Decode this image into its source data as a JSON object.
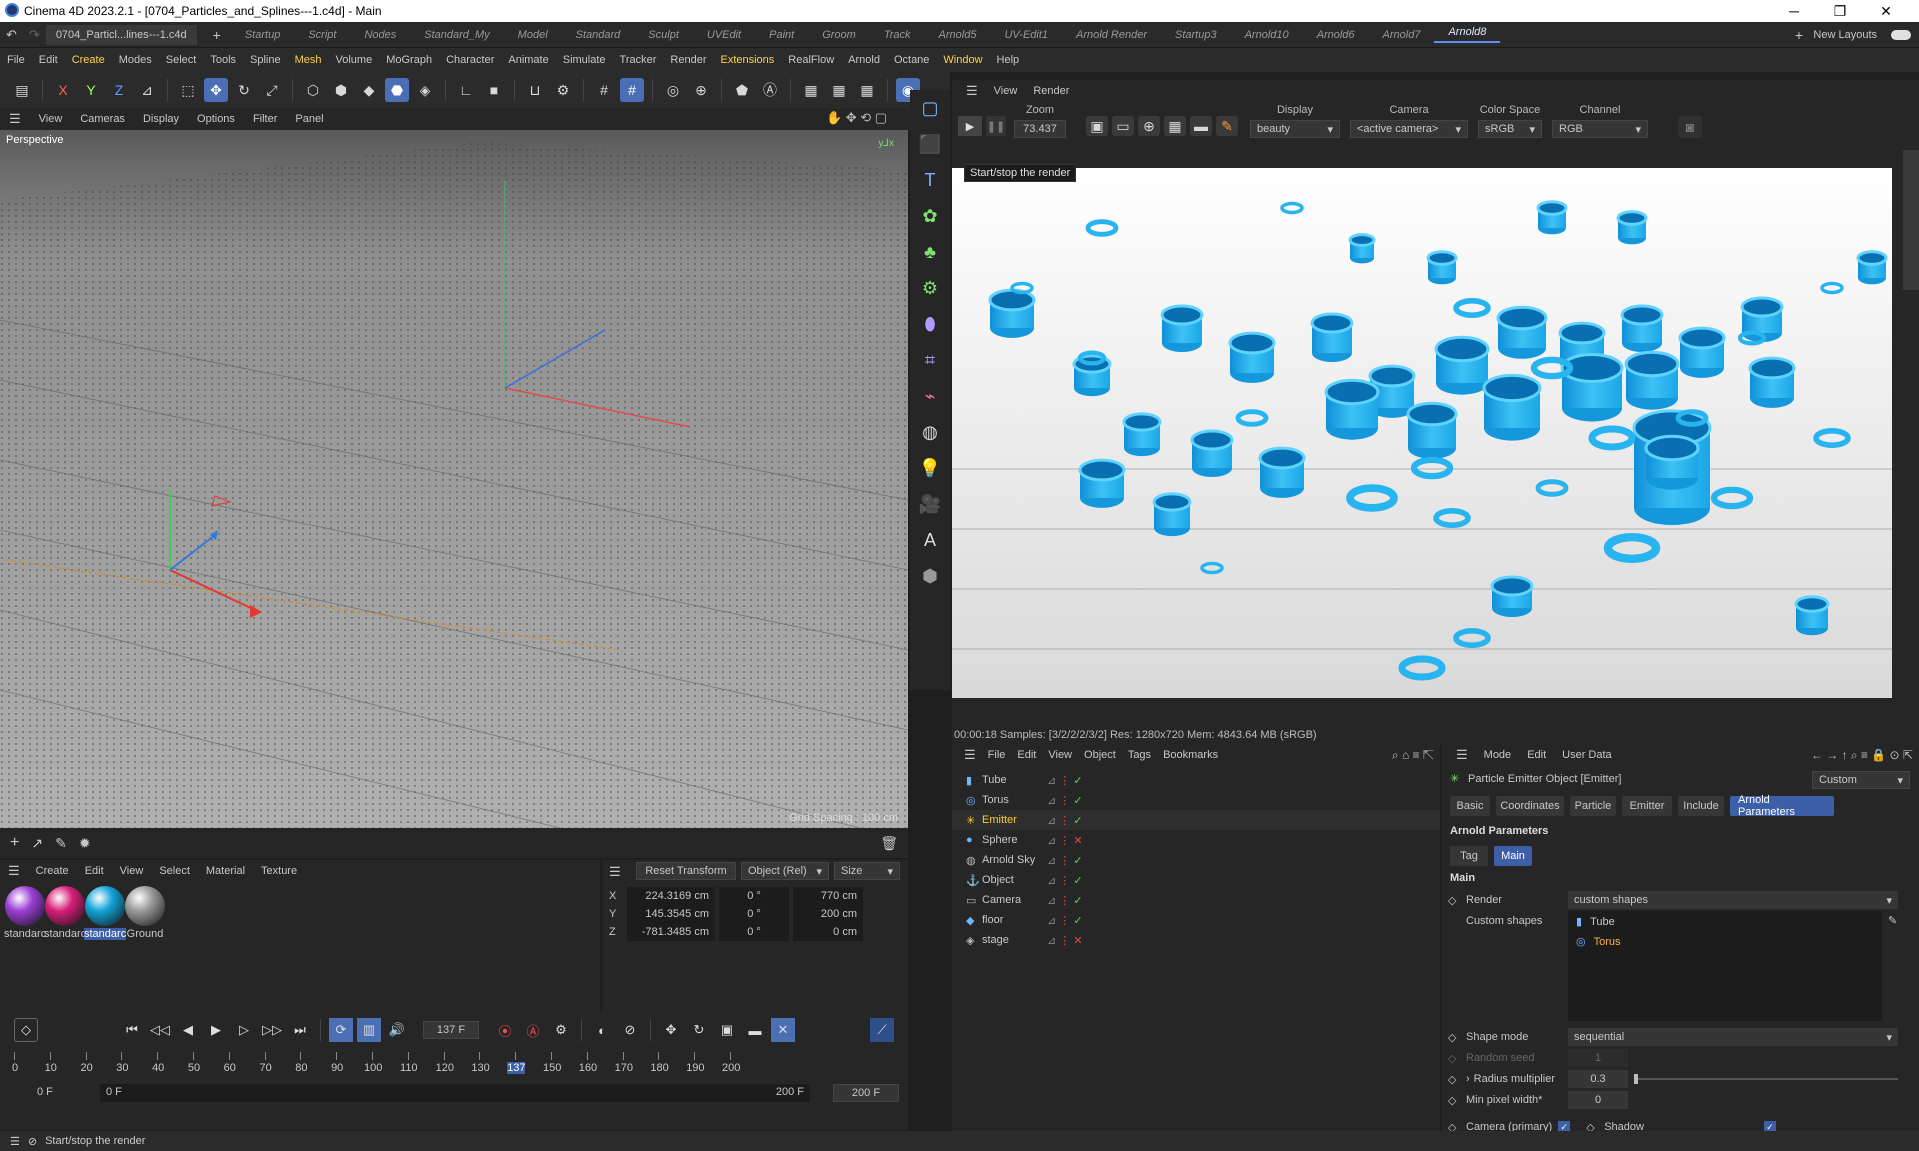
{
  "window": {
    "title": "Cinema 4D 2023.2.1 - [0704_Particles_and_Splines---1.c4d] - Main",
    "minimize": "─",
    "maximize": "❐",
    "close": "✕"
  },
  "file_tab": {
    "label": "0704_Particl...lines---1.c4d",
    "add": "+"
  },
  "layout_tabs": [
    "Startup",
    "Script",
    "Nodes",
    "Standard_My",
    "Model",
    "Standard",
    "Sculpt",
    "UVEdit",
    "Paint",
    "Groom",
    "Track",
    "Arnold5",
    "UV-Edit1",
    "Arnold Render",
    "Startup3",
    "Arnold10",
    "Arnold6",
    "Arnold7",
    "Arnold8"
  ],
  "active_layout": "Arnold8",
  "new_layouts": "New Layouts",
  "menu": [
    "File",
    "Edit",
    "Create",
    "Modes",
    "Select",
    "Tools",
    "Spline",
    "Mesh",
    "Volume",
    "MoGraph",
    "Character",
    "Animate",
    "Simulate",
    "Tracker",
    "Render",
    "Extensions",
    "RealFlow",
    "Arnold",
    "Octane",
    "Window",
    "Help"
  ],
  "menu_highlight": [
    "Create",
    "Mesh",
    "Extensions",
    "Window"
  ],
  "viewport_menu": [
    "View",
    "Cameras",
    "Display",
    "Options",
    "Filter",
    "Panel"
  ],
  "viewport": {
    "label": "Perspective",
    "grid_info": "Grid Spacing : 100 cm"
  },
  "render_view": {
    "menu": [
      "View",
      "Render"
    ],
    "zoom_label": "Zoom",
    "zoom_value": "73.437",
    "display_label": "Display",
    "display_value": "beauty",
    "camera_label": "Camera",
    "camera_value": "<active camera>",
    "colorspace_label": "Color Space",
    "colorspace_value": "sRGB",
    "channel_label": "Channel",
    "channel_value": "RGB",
    "tooltip": "Start/stop the render",
    "status": "00:00:18  Samples: [3/2/2/2/3/2]  Res: 1280x720  Mem: 4843.64 MB  (sRGB)"
  },
  "material_menu": [
    "Create",
    "Edit",
    "View",
    "Select",
    "Material",
    "Texture"
  ],
  "materials": [
    {
      "label": "standarc",
      "color": "#9b3fd6"
    },
    {
      "label": "standarc",
      "color": "#d81f79"
    },
    {
      "label": "standarc",
      "color": "#12a3d8"
    },
    {
      "label": "Ground",
      "color": "#9a9a9a"
    }
  ],
  "coords": {
    "reset": "Reset Transform",
    "mode": "Object (Rel)",
    "size": "Size",
    "rows": [
      {
        "axis": "X",
        "pos": "224.3169 cm",
        "rot": "0 °",
        "size": "770 cm"
      },
      {
        "axis": "Y",
        "pos": "145.3545 cm",
        "rot": "0 °",
        "size": "200 cm"
      },
      {
        "axis": "Z",
        "pos": "-781.3485 cm",
        "rot": "0 °",
        "size": "0 cm"
      }
    ]
  },
  "timeline": {
    "current_frame": "137 F",
    "ticks": [
      "0",
      "10",
      "20",
      "30",
      "40",
      "50",
      "60",
      "70",
      "80",
      "90",
      "100",
      "110",
      "120",
      "130",
      "137",
      "150",
      "160",
      "170",
      "180",
      "190",
      "200"
    ],
    "start": "0 F",
    "start2": "0 F",
    "end": "200 F",
    "end2": "200 F"
  },
  "object_manager": {
    "menu": [
      "File",
      "Edit",
      "View",
      "Object",
      "Tags",
      "Bookmarks"
    ],
    "objects": [
      {
        "name": "Tube",
        "icon": "▮",
        "color": "#6fb5ff"
      },
      {
        "name": "Torus",
        "icon": "◎",
        "color": "#6fb5ff"
      },
      {
        "name": "Emitter",
        "icon": "✳",
        "color": "#ffcc33",
        "selected": true
      },
      {
        "name": "Sphere",
        "icon": "●",
        "color": "#6fb5ff"
      },
      {
        "name": "Arnold Sky",
        "icon": "◍",
        "color": "#bbbbbb"
      },
      {
        "name": "Object",
        "icon": "⚓",
        "color": "#bbbbbb"
      },
      {
        "name": "Camera",
        "icon": "▭",
        "color": "#bbbbbb"
      },
      {
        "name": "floor",
        "icon": "◆",
        "color": "#6fb5ff"
      },
      {
        "name": "stage",
        "icon": "◈",
        "color": "#bbbbbb"
      }
    ]
  },
  "attributes": {
    "menu": [
      "Mode",
      "Edit",
      "User Data"
    ],
    "object_title": "Particle Emitter Object [Emitter]",
    "preset": "Custom",
    "tabs": [
      "Basic",
      "Coordinates",
      "Particle",
      "Emitter",
      "Include",
      "Arnold Parameters"
    ],
    "section": "Arnold Parameters",
    "subtabs": [
      "Tag",
      "Main"
    ],
    "main_label": "Main",
    "render_label": "Render",
    "render_value": "custom shapes",
    "custom_shapes_label": "Custom shapes",
    "custom_shapes": [
      "Tube",
      "Torus"
    ],
    "shape_mode_label": "Shape mode",
    "shape_mode_value": "sequential",
    "random_seed_label": "Random seed",
    "random_seed_value": "1",
    "radius_label": "Radius multiplier",
    "radius_value": "0.3",
    "minpx_label": "Min pixel width*",
    "minpx_value": "0",
    "camera_label": "Camera (primary)",
    "shadow_label": "Shadow"
  },
  "status": "Start/stop the render"
}
